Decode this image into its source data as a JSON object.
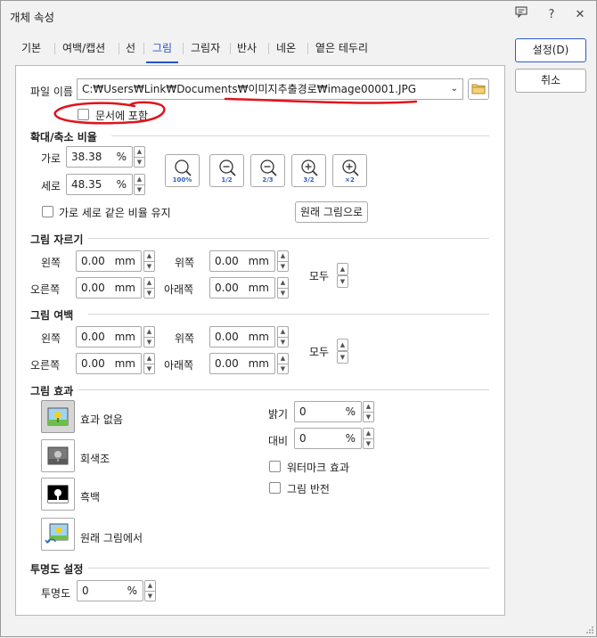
{
  "window": {
    "title": "개체 속성",
    "help_icon": "?",
    "close_icon": "✕"
  },
  "tabs": [
    "기본",
    "여백/캡션",
    "선",
    "그림",
    "그림자",
    "반사",
    "네온",
    "옅은 테두리"
  ],
  "buttons": {
    "ok": "설정(D)",
    "cancel": "취소"
  },
  "file": {
    "label": "파일 이름",
    "path": "C:₩Users₩Link₩Documents₩이미지추출경로₩image00001.JPG",
    "embed_label": "문서에 포함"
  },
  "scale": {
    "section": "확대/축소 비율",
    "width_label": "가로",
    "width_value": "38.38",
    "width_unit": "%",
    "height_label": "세로",
    "height_value": "48.35",
    "height_unit": "%",
    "zoom_buttons": [
      "100%",
      "1/2",
      "2/3",
      "3/2",
      "×2"
    ],
    "keep_ratio_label": "가로 세로 같은 비율 유지",
    "original_button": "원래 그림으로"
  },
  "crop": {
    "section": "그림 자르기",
    "left_label": "왼쪽",
    "left_value": "0.00",
    "right_label": "오른쪽",
    "right_value": "0.00",
    "top_label": "위쪽",
    "top_value": "0.00",
    "bottom_label": "아래쪽",
    "bottom_value": "0.00",
    "unit": "mm",
    "all_label": "모두"
  },
  "margin": {
    "section": "그림 여백",
    "left_label": "왼쪽",
    "left_value": "0.00",
    "right_label": "오른쪽",
    "right_value": "0.00",
    "top_label": "위쪽",
    "top_value": "0.00",
    "bottom_label": "아래쪽",
    "bottom_value": "0.00",
    "unit": "mm",
    "all_label": "모두"
  },
  "effect": {
    "section": "그림 효과",
    "options": [
      "효과 없음",
      "회색조",
      "흑백",
      "원래 그림에서"
    ],
    "brightness_label": "밝기",
    "brightness_value": "0",
    "brightness_unit": "%",
    "contrast_label": "대비",
    "contrast_value": "0",
    "contrast_unit": "%",
    "watermark_label": "워터마크 효과",
    "invert_label": "그림 반전"
  },
  "transparency": {
    "section": "투명도 설정",
    "label": "투명도",
    "value": "0",
    "unit": "%"
  },
  "colors": {
    "accent": "#2355c8",
    "annotation": "#e0141e"
  }
}
